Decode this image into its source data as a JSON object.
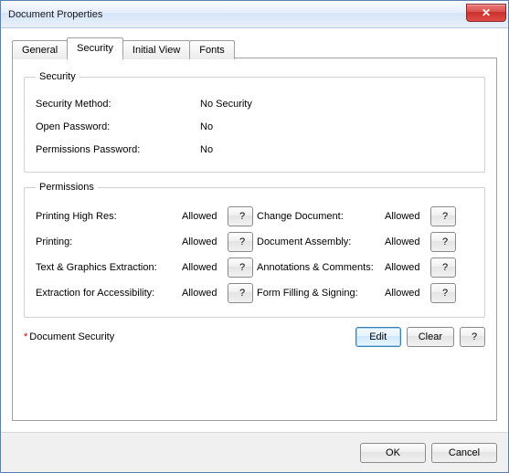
{
  "window": {
    "title": "Document Properties",
    "close_glyph": "✕"
  },
  "tabs": {
    "general": "General",
    "security": "Security",
    "initial_view": "Initial View",
    "fonts": "Fonts"
  },
  "security_group": {
    "legend": "Security",
    "method_label": "Security Method:",
    "method_value": "No Security",
    "open_pw_label": "Open Password:",
    "open_pw_value": "No",
    "perm_pw_label": "Permissions Password:",
    "perm_pw_value": "No"
  },
  "permissions_group": {
    "legend": "Permissions",
    "left": [
      {
        "label": "Printing High Res:",
        "value": "Allowed"
      },
      {
        "label": "Printing:",
        "value": "Allowed"
      },
      {
        "label": "Text & Graphics Extraction:",
        "value": "Allowed"
      },
      {
        "label": "Extraction for Accessibility:",
        "value": "Allowed"
      }
    ],
    "right": [
      {
        "label": "Change Document:",
        "value": "Allowed"
      },
      {
        "label": "Document Assembly:",
        "value": "Allowed"
      },
      {
        "label": "Annotations & Comments:",
        "value": "Allowed"
      },
      {
        "label": "Form Filling & Signing:",
        "value": "Allowed"
      }
    ],
    "help_glyph": "?"
  },
  "docsec": {
    "star": "*",
    "label": "Document Security",
    "edit": "Edit",
    "clear": "Clear",
    "help": "?"
  },
  "footer": {
    "ok": "OK",
    "cancel": "Cancel"
  }
}
